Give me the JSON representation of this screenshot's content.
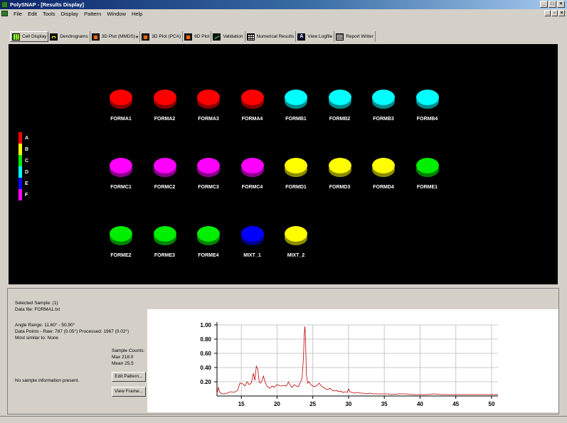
{
  "window": {
    "title": "PolySNAP - [Results Display]",
    "min_label": "_",
    "max_label": "□",
    "close_label": "×"
  },
  "menu": [
    "File",
    "Edit",
    "Tools",
    "Display",
    "Pattern",
    "Window",
    "Help"
  ],
  "mdi": {
    "min_label": "_",
    "restore_label": "▫",
    "close_label": "×"
  },
  "toolbar": {
    "tabs": [
      {
        "label": "Cell Display",
        "icon": "grid-icon",
        "active": true
      },
      {
        "label": "Dendrograms",
        "icon": "dendrogram-icon"
      },
      {
        "label": "3D Plot (MMDS)",
        "icon": "3d-plot-icon",
        "suffix": "▾"
      },
      {
        "label": "3D Plot (PCA)",
        "icon": "3d-plot-icon"
      },
      {
        "label": "6D Plot",
        "icon": "6d-plot-icon"
      },
      {
        "label": "Validation",
        "icon": "validation-icon"
      },
      {
        "label": "Numerical Results",
        "icon": "table-icon"
      },
      {
        "label": "View Logfile",
        "icon": "logfile-icon",
        "glyph": "A"
      },
      {
        "label": "Report Writer",
        "icon": "report-icon"
      }
    ]
  },
  "legend": [
    {
      "label": "A",
      "color": "#ff0000"
    },
    {
      "label": "B",
      "color": "#ffff00"
    },
    {
      "label": "C",
      "color": "#00ee00"
    },
    {
      "label": "D",
      "color": "#00ffff"
    },
    {
      "label": "E",
      "color": "#0000ff"
    },
    {
      "label": "F",
      "color": "#ff00ff"
    }
  ],
  "samples": [
    {
      "label": "FORMA1",
      "class": "A",
      "row": 0,
      "col": 0
    },
    {
      "label": "FORMA2",
      "class": "A",
      "row": 0,
      "col": 1
    },
    {
      "label": "FORMA3",
      "class": "A",
      "row": 0,
      "col": 2
    },
    {
      "label": "FORMA4",
      "class": "A",
      "row": 0,
      "col": 3
    },
    {
      "label": "FORMB1",
      "class": "D",
      "row": 0,
      "col": 4
    },
    {
      "label": "FORMB2",
      "class": "D",
      "row": 0,
      "col": 5
    },
    {
      "label": "FORMB3",
      "class": "D",
      "row": 0,
      "col": 6
    },
    {
      "label": "FORMB4",
      "class": "D",
      "row": 0,
      "col": 7
    },
    {
      "label": "FORMC1",
      "class": "F",
      "row": 1,
      "col": 0
    },
    {
      "label": "FORMC2",
      "class": "F",
      "row": 1,
      "col": 1
    },
    {
      "label": "FORMC3",
      "class": "F",
      "row": 1,
      "col": 2
    },
    {
      "label": "FORMC4",
      "class": "F",
      "row": 1,
      "col": 3
    },
    {
      "label": "FORMD1",
      "class": "B",
      "row": 1,
      "col": 4
    },
    {
      "label": "FORMD3",
      "class": "B",
      "row": 1,
      "col": 5
    },
    {
      "label": "FORMD4",
      "class": "B",
      "row": 1,
      "col": 6
    },
    {
      "label": "FORME1",
      "class": "C",
      "row": 1,
      "col": 7
    },
    {
      "label": "FORME2",
      "class": "C",
      "row": 2,
      "col": 0
    },
    {
      "label": "FORME3",
      "class": "C",
      "row": 2,
      "col": 1
    },
    {
      "label": "FORME4",
      "class": "C",
      "row": 2,
      "col": 2
    },
    {
      "label": "MIXT_1",
      "class": "E",
      "row": 2,
      "col": 3
    },
    {
      "label": "MIXT_2",
      "class": "B",
      "row": 2,
      "col": 4
    }
  ],
  "info": {
    "selected_sample": "Selected Sample: (1)",
    "data_file": "Data file:  FORMA1.txt",
    "angle_range": "Angle Range:        11.60° - 50.90°",
    "data_points": "Data Points - Raw: 787 (0.05°)     Processed: 1967 (0.02°)",
    "most_similar": "Most similar to: None",
    "sample_counts_title": "Sample Counts:",
    "max": "Max   218.0",
    "mean": "Mean  25.5",
    "no_info": "No sample information present.",
    "edit_pattern": "Edit Pattern...",
    "view_frame": "View Frame..."
  },
  "chart_data": {
    "type": "line",
    "title": "",
    "xlabel": "",
    "ylabel": "",
    "xlim": [
      11.6,
      50.9
    ],
    "ylim": [
      0,
      1.0
    ],
    "xticks": [
      15,
      20,
      25,
      30,
      35,
      40,
      45,
      50
    ],
    "yticks": [
      0.2,
      0.4,
      0.6,
      0.8,
      1.0
    ],
    "ytick_labels": [
      "0.20",
      "0.40",
      "0.60",
      "0.80",
      "1.00"
    ],
    "grid": true,
    "line_color": "#c00000",
    "series": [
      {
        "x": [
          11.6,
          11.8,
          12.0,
          12.3,
          12.6,
          13.0,
          13.5,
          14.0,
          14.5,
          14.8,
          15.2,
          15.5,
          15.8,
          16.1,
          16.4,
          16.7,
          16.9,
          17.1,
          17.3,
          17.5,
          17.7,
          17.9,
          18.1,
          18.4,
          18.6,
          18.8,
          19.0,
          19.3,
          19.6,
          20.0,
          20.5,
          21.0,
          21.3,
          21.6,
          21.8,
          22.1,
          22.4,
          22.7,
          23.0,
          23.3,
          23.5,
          23.7,
          23.8,
          23.9,
          24.0,
          24.1,
          24.3,
          24.5,
          24.7,
          25.0,
          25.3,
          25.6,
          25.9,
          26.2,
          26.5,
          26.8,
          27.1,
          27.4,
          27.7,
          28.0,
          28.3,
          28.6,
          28.9,
          29.2,
          29.5,
          29.8,
          30.0,
          30.2,
          30.5,
          30.9,
          31.3,
          31.7,
          32.1,
          32.5,
          33.0,
          33.5,
          34.0,
          34.5,
          35.0,
          35.5,
          36.0,
          37.0,
          38.0,
          39.0,
          40.0,
          41.0,
          42.0,
          43.0,
          44.0,
          45.0,
          46.0,
          47.0,
          48.0,
          49.0,
          50.0,
          50.9
        ],
        "y": [
          0.04,
          0.12,
          0.05,
          0.03,
          0.03,
          0.04,
          0.06,
          0.05,
          0.08,
          0.18,
          0.17,
          0.14,
          0.2,
          0.16,
          0.18,
          0.32,
          0.22,
          0.42,
          0.38,
          0.2,
          0.18,
          0.22,
          0.28,
          0.18,
          0.14,
          0.12,
          0.11,
          0.14,
          0.12,
          0.16,
          0.14,
          0.15,
          0.14,
          0.2,
          0.16,
          0.12,
          0.16,
          0.14,
          0.13,
          0.2,
          0.25,
          0.55,
          0.85,
          0.98,
          0.78,
          0.3,
          0.18,
          0.2,
          0.16,
          0.14,
          0.13,
          0.15,
          0.18,
          0.14,
          0.12,
          0.1,
          0.09,
          0.11,
          0.08,
          0.07,
          0.08,
          0.06,
          0.07,
          0.05,
          0.06,
          0.05,
          0.1,
          0.06,
          0.05,
          0.04,
          0.05,
          0.04,
          0.04,
          0.03,
          0.04,
          0.03,
          0.03,
          0.03,
          0.03,
          0.03,
          0.02,
          0.03,
          0.03,
          0.02,
          0.02,
          0.02,
          0.03,
          0.02,
          0.02,
          0.02,
          0.02,
          0.02,
          0.02,
          0.02,
          0.02,
          0.02
        ]
      }
    ]
  }
}
